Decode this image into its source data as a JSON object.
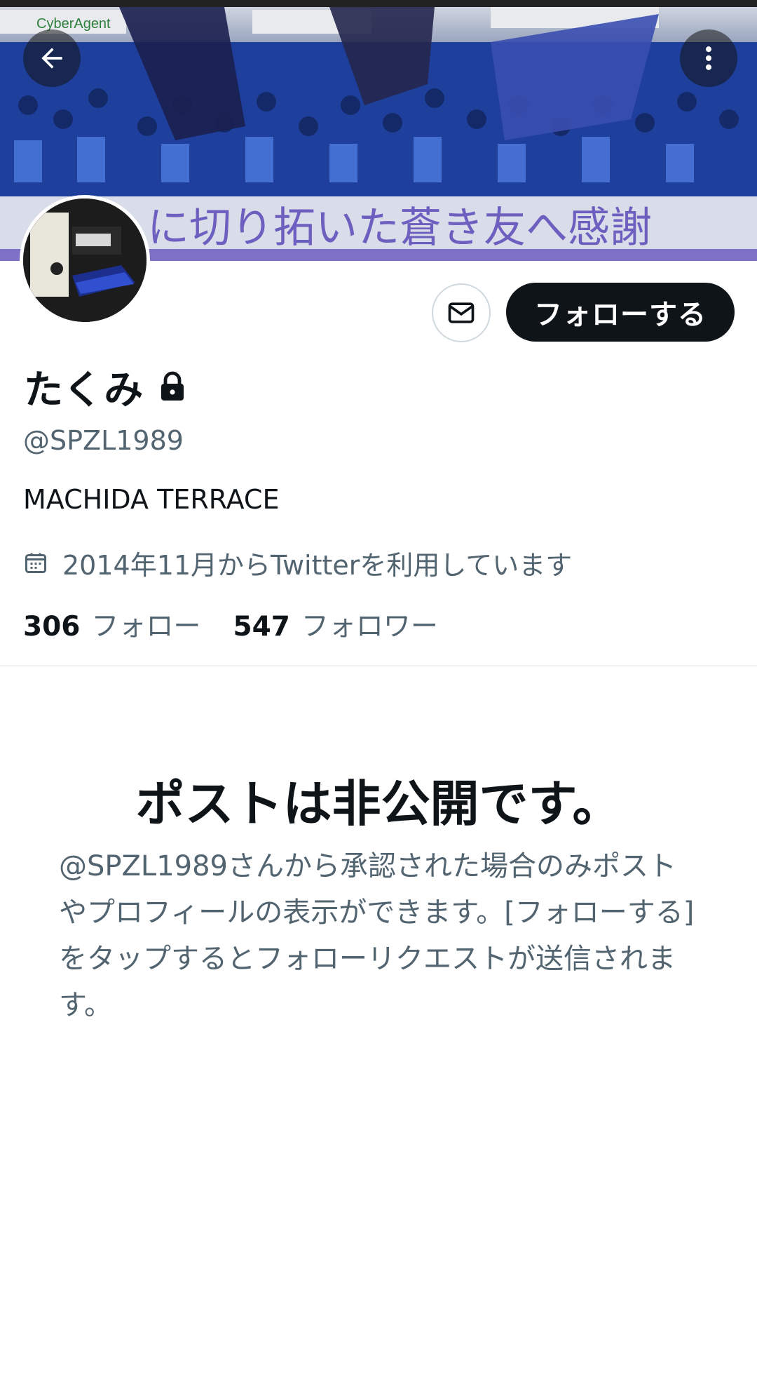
{
  "profile": {
    "name": "たくみ",
    "handle": "@SPZL1989",
    "bio": "MACHIDA TERRACE",
    "joined": "2014年11月からTwitterを利用しています",
    "following_count": "306",
    "following_label": "フォロー",
    "followers_count": "547",
    "followers_label": "フォロワー"
  },
  "banner": {
    "sponsor_text": "CyberAgent",
    "banner_slogan": "に切り拓いた蒼き友へ感謝"
  },
  "actions": {
    "follow_label": "フォローする"
  },
  "protected_notice": {
    "title": "ポストは非公開です。",
    "body": "@SPZL1989さんから承認された場合のみポストやプロフィールの表示ができます。[フォローする] をタップするとフォローリクエストが送信されます。"
  },
  "icons": {
    "back": "arrow-left-icon",
    "more": "more-vertical-icon",
    "message": "envelope-icon",
    "lock": "lock-icon",
    "calendar": "calendar-icon"
  },
  "colors": {
    "text_primary": "#0f1419",
    "text_secondary": "#536471",
    "border": "#cfd9de",
    "follow_bg": "#0f1419"
  }
}
